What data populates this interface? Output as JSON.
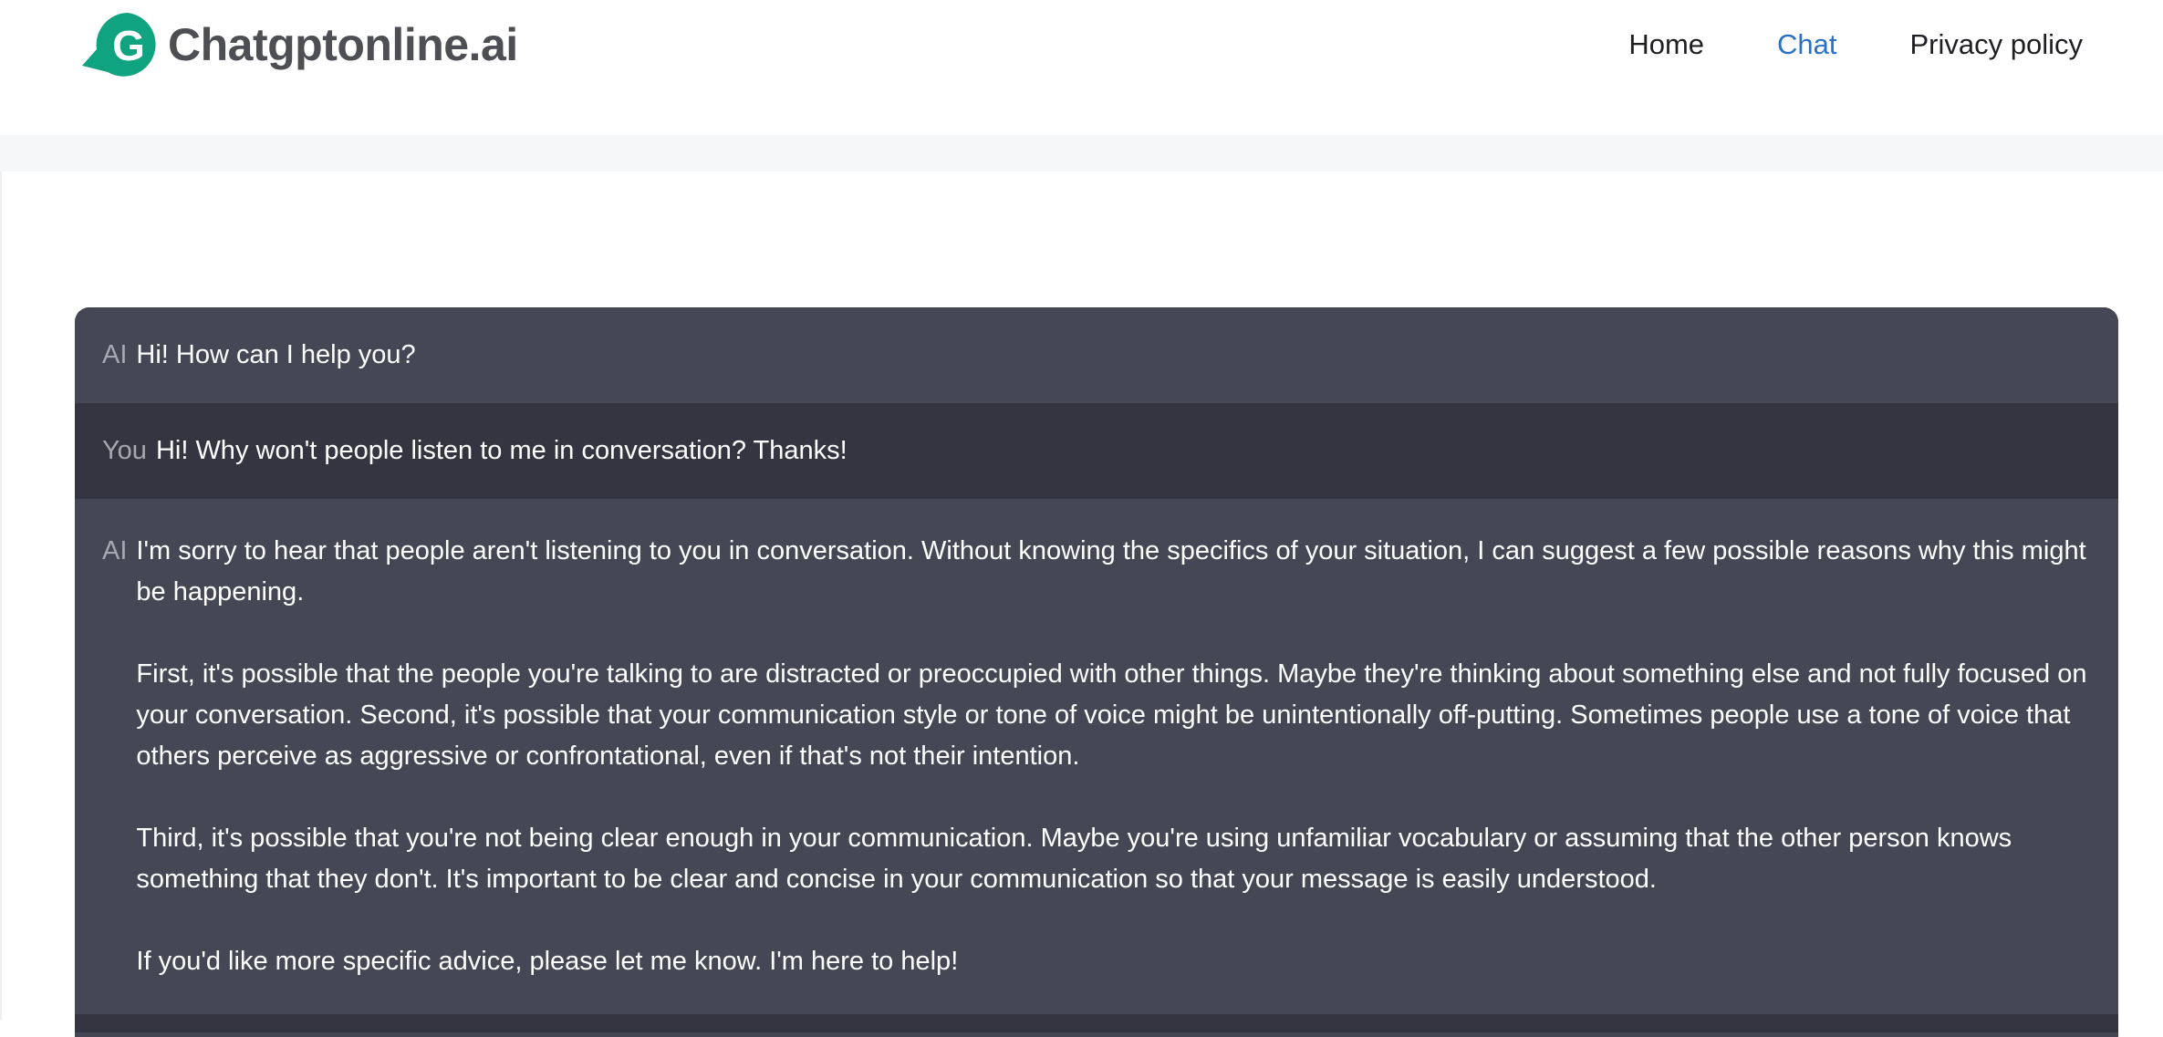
{
  "header": {
    "logo_text": "Chatgptonline.ai",
    "logo_icon": "g-logo-icon",
    "brand_color": "#10a37f",
    "nav": [
      {
        "label": "Home",
        "active": false
      },
      {
        "label": "Chat",
        "active": true
      },
      {
        "label": "Privacy policy",
        "active": false
      }
    ],
    "active_color": "#2a72c4"
  },
  "chat": {
    "messages": [
      {
        "role": "AI",
        "paragraphs": [
          "Hi! How can I help you?"
        ]
      },
      {
        "role": "You",
        "paragraphs": [
          "Hi! Why won't people listen to me in conversation? Thanks!"
        ]
      },
      {
        "role": "AI",
        "paragraphs": [
          "I'm sorry to hear that people aren't listening to you in conversation. Without knowing the specifics of your situation, I can suggest a few possible reasons why this might be happening.",
          "First, it's possible that the people you're talking to are distracted or preoccupied with other things. Maybe they're thinking about something else and not fully focused on your conversation. Second, it's possible that your communication style or tone of voice might be unintentionally off-putting. Sometimes people use a tone of voice that others perceive as aggressive or confrontational, even if that's not their intention.",
          "Third, it's possible that you're not being clear enough in your communication. Maybe you're using unfamiliar vocabulary or assuming that the other person knows something that they don't. It's important to be clear and concise in your communication so that your message is easily understood.",
          "If you'd like more specific advice, please let me know. I'm here to help!"
        ]
      }
    ],
    "colors": {
      "ai_bg": "#454755",
      "user_bg": "#353541",
      "role_label": "#a6a7b0",
      "text": "#ffffff"
    }
  }
}
